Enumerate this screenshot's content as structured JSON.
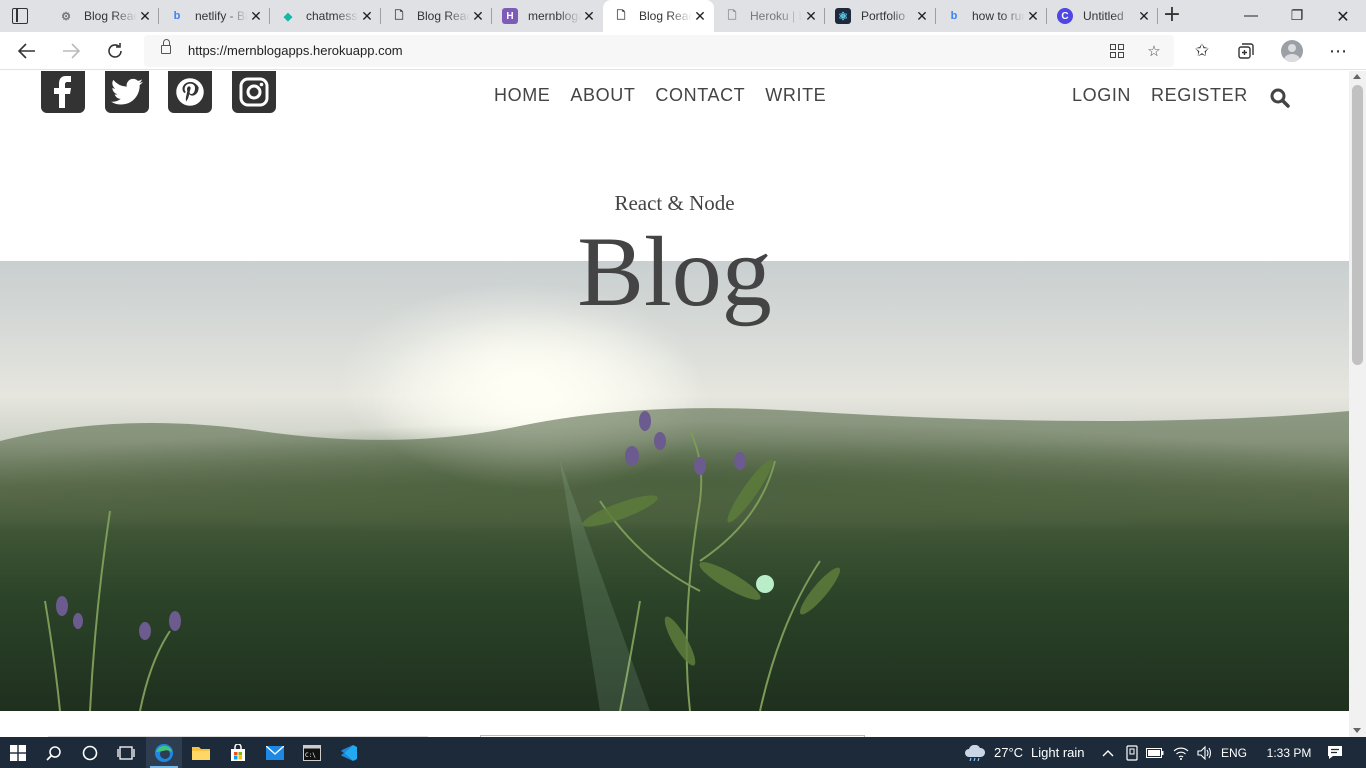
{
  "browser": {
    "tabs": [
      {
        "title": "Blog React",
        "favicon": "react-gear-icon"
      },
      {
        "title": "netlify - Bing",
        "favicon": "bing-icon"
      },
      {
        "title": "chatmessenger",
        "favicon": "diamond-icon"
      },
      {
        "title": "Blog React",
        "favicon": "document-icon"
      },
      {
        "title": "mernblogapps",
        "favicon": "heroku-icon"
      },
      {
        "title": "Blog React",
        "favicon": "document-icon",
        "active": true
      },
      {
        "title": "Heroku | Login",
        "favicon": "document-icon"
      },
      {
        "title": "Portfolio",
        "favicon": "react-icon"
      },
      {
        "title": "how to run",
        "favicon": "bing-icon"
      },
      {
        "title": "Untitled",
        "favicon": "canva-icon"
      }
    ],
    "url": "https://mernblogapps.herokuapp.com"
  },
  "site": {
    "menu": [
      "HOME",
      "ABOUT",
      "CONTACT",
      "WRITE"
    ],
    "auth": [
      "LOGIN",
      "REGISTER"
    ],
    "social": [
      "facebook-icon",
      "twitter-icon",
      "pinterest-icon",
      "instagram-icon"
    ],
    "hero": {
      "subtitle": "React & Node",
      "title": "Blog"
    }
  },
  "taskbar": {
    "weather": {
      "temp": "27°C",
      "condition": "Light rain"
    },
    "language": "ENG",
    "time": "1:33 PM"
  },
  "colors": {
    "text": "#444444",
    "icon_tile": "#333333",
    "taskbar": "#1c2a3a"
  }
}
